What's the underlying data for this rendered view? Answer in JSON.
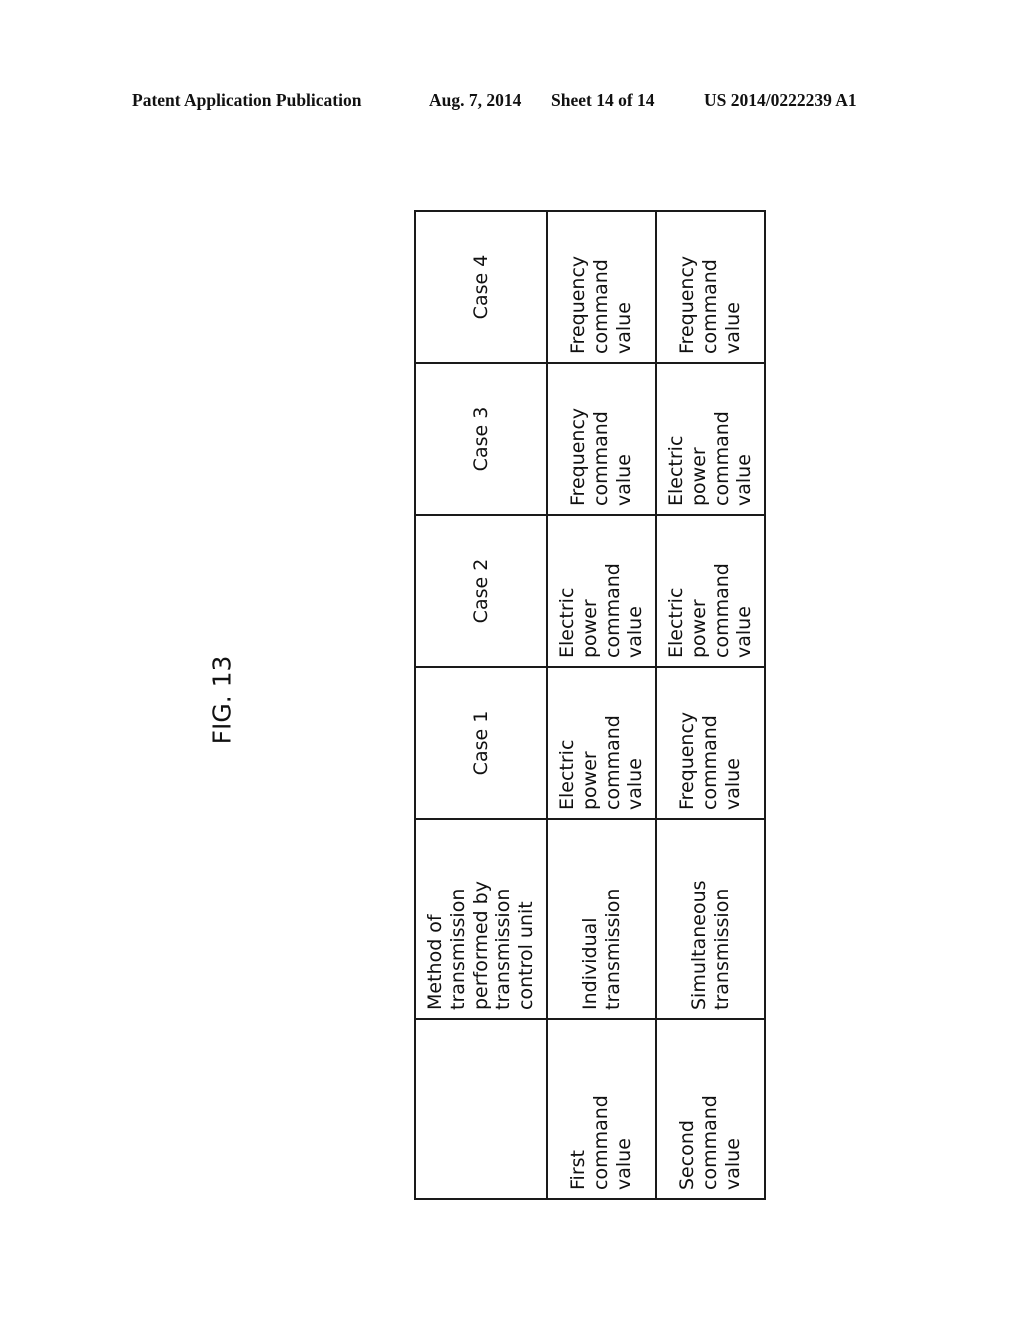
{
  "header": {
    "publication": "Patent Application Publication",
    "date": "Aug. 7, 2014",
    "sheet": "Sheet 14 of 14",
    "number": "US 2014/0222239 A1"
  },
  "figure": {
    "label": "FIG. 13"
  },
  "table": {
    "corner": "",
    "method_header": "Method of\ntransmission\nperformed by\ntransmission\ncontrol unit",
    "cases": [
      "Case 1",
      "Case 2",
      "Case 3",
      "Case 4"
    ],
    "rows": [
      {
        "label": "First\ncommand\nvalue",
        "method": "Individual\ntransmission",
        "values": [
          "Electric\npower\ncommand\nvalue",
          "Electric\npower\ncommand\nvalue",
          "Frequency\ncommand\nvalue",
          "Frequency\ncommand\nvalue"
        ]
      },
      {
        "label": "Second\ncommand\nvalue",
        "method": "Simultaneous\ntransmission",
        "values": [
          "Frequency\ncommand\nvalue",
          "Electric\npower\ncommand\nvalue",
          "Electric\npower\ncommand\nvalue",
          "Frequency\ncommand\nvalue"
        ]
      }
    ]
  }
}
